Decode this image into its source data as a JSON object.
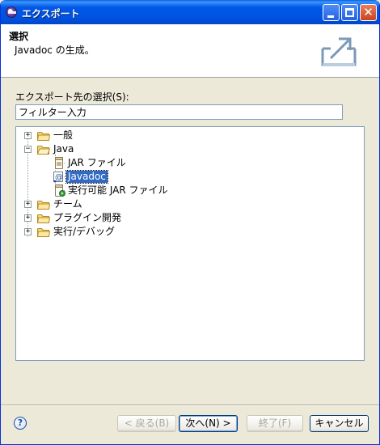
{
  "window": {
    "title": "エクスポート"
  },
  "banner": {
    "title": "選択",
    "description": "Javadoc の生成。"
  },
  "destination": {
    "label": "エクスポート先の選択(S):",
    "filter_value": "フィルター入力"
  },
  "tree": {
    "nodes": [
      {
        "label": "一般",
        "expander": "+"
      },
      {
        "label": "Java",
        "expander": "−"
      },
      {
        "label": "JAR ファイル"
      },
      {
        "label": "Javadoc",
        "selected": true
      },
      {
        "label": "実行可能 JAR ファイル"
      },
      {
        "label": "チーム",
        "expander": "+"
      },
      {
        "label": "プラグイン開発",
        "expander": "+"
      },
      {
        "label": "実行/デバッグ",
        "expander": "+"
      }
    ]
  },
  "buttons": {
    "help": "?",
    "back": "< 戻る(B)",
    "next": "次へ(N) >",
    "finish": "終了(F)",
    "cancel": "キャンセル"
  },
  "colors": {
    "titlebar": "#0054e3",
    "selection": "#316ac5",
    "dialog_bg": "#ece9d8"
  }
}
